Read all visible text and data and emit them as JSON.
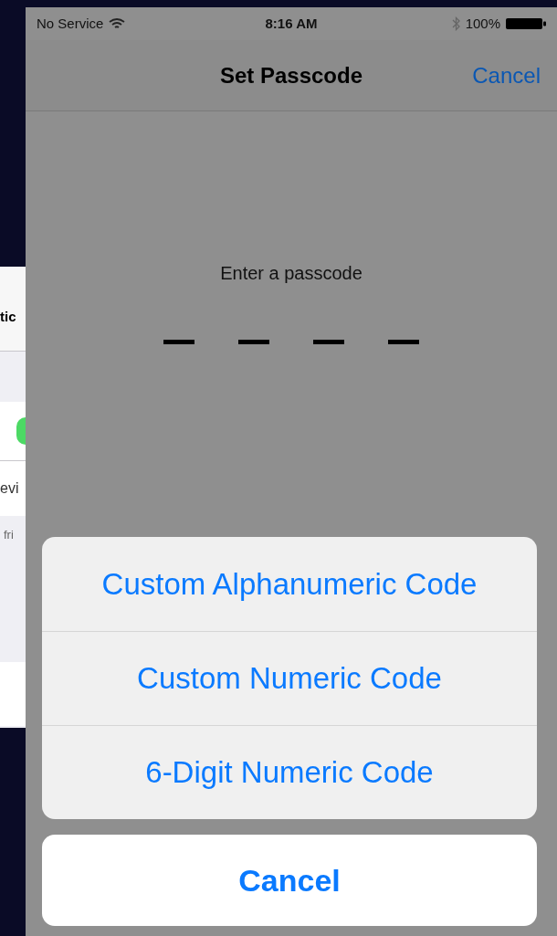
{
  "background_screen": {
    "title": "tic",
    "row_label": "evi",
    "footer_note": "fri",
    "toggle": {
      "on": true
    }
  },
  "status_bar": {
    "carrier": "No Service",
    "time": "8:16 AM",
    "battery": "100%"
  },
  "nav_bar": {
    "title": "Set Passcode",
    "cancel": "Cancel"
  },
  "prompt": "Enter a passcode",
  "slots": [
    {
      "filled": false
    },
    {
      "filled": false
    },
    {
      "filled": false
    },
    {
      "filled": false
    }
  ],
  "action_sheet": {
    "options": [
      "Custom Alphanumeric Code",
      "Custom Numeric Code",
      "6-Digit Numeric Code"
    ],
    "cancel": "Cancel"
  }
}
